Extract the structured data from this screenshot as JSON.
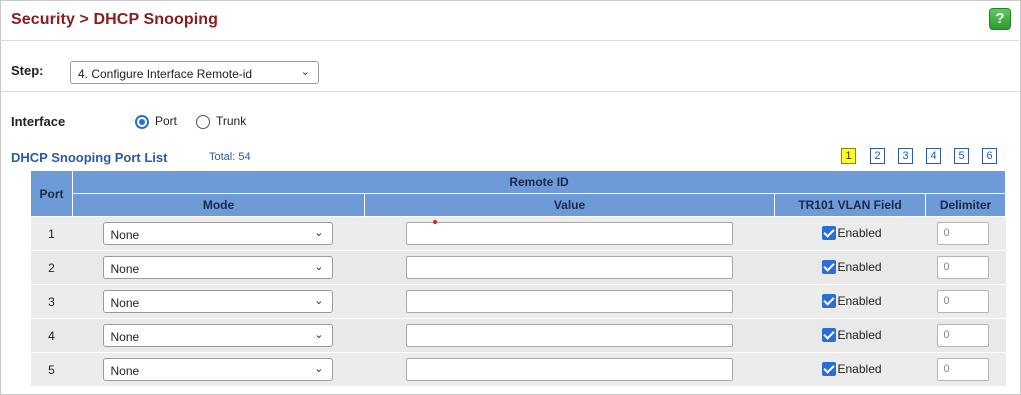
{
  "header": {
    "title": "Security > DHCP Snooping",
    "help_label": "?"
  },
  "step": {
    "label": "Step:",
    "selected": "4. Configure Interface Remote-id"
  },
  "interface": {
    "label": "Interface",
    "options": [
      {
        "label": "Port",
        "selected": true
      },
      {
        "label": "Trunk",
        "selected": false
      }
    ]
  },
  "port_list": {
    "title": "DHCP Snooping Port List",
    "total": "Total: 54",
    "pages": [
      "1",
      "2",
      "3",
      "4",
      "5",
      "6"
    ],
    "current_page": "1"
  },
  "table": {
    "headers": {
      "port": "Port",
      "remote_id": "Remote ID",
      "mode": "Mode",
      "value": "Value",
      "tr101": "TR101 VLAN Field",
      "delimiter": "Delimiter"
    },
    "rows": [
      {
        "port": "1",
        "mode": "None",
        "value": "",
        "tr101_checked": true,
        "tr101_label": "Enabled",
        "delimiter": "0"
      },
      {
        "port": "2",
        "mode": "None",
        "value": "",
        "tr101_checked": true,
        "tr101_label": "Enabled",
        "delimiter": "0"
      },
      {
        "port": "3",
        "mode": "None",
        "value": "",
        "tr101_checked": true,
        "tr101_label": "Enabled",
        "delimiter": "0"
      },
      {
        "port": "4",
        "mode": "None",
        "value": "",
        "tr101_checked": true,
        "tr101_label": "Enabled",
        "delimiter": "0"
      },
      {
        "port": "5",
        "mode": "None",
        "value": "",
        "tr101_checked": true,
        "tr101_label": "Enabled",
        "delimiter": "0"
      }
    ]
  },
  "colors": {
    "title": "#8a1c1c",
    "accent_blue": "#2a5aa8",
    "header_bg": "#6e9ad8",
    "checkbox": "#2a6fd6",
    "current_page_bg": "#ffff22"
  }
}
